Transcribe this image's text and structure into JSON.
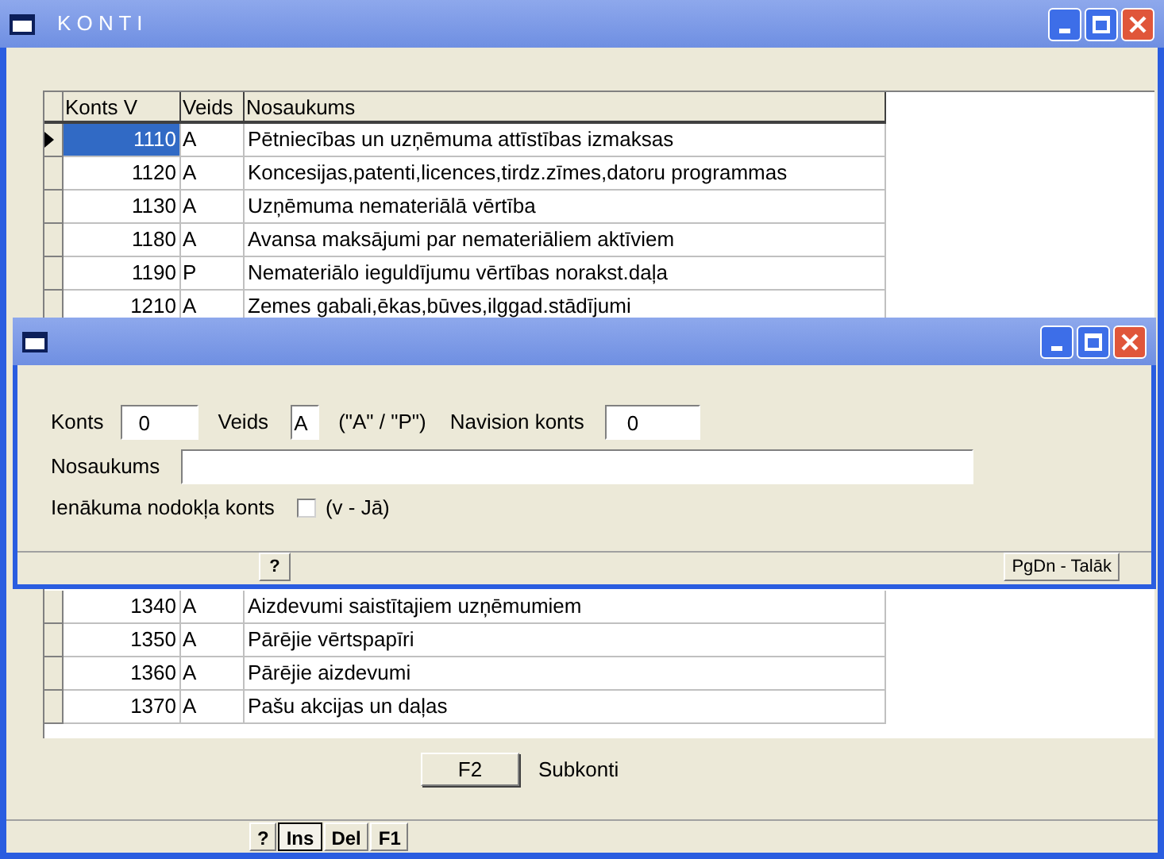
{
  "window": {
    "title": "K O N T I"
  },
  "table": {
    "columns": [
      "Konts V",
      "Veids",
      "Nosaukums"
    ],
    "rows": [
      {
        "konts": "1110",
        "veids": "A",
        "nosaukums": "Pētniecības un uzņēmuma attīstības izmaksas",
        "selected": true
      },
      {
        "konts": "1120",
        "veids": "A",
        "nosaukums": "Koncesijas,patenti,licences,tirdz.zīmes,datoru programmas",
        "selected": false
      },
      {
        "konts": "1130",
        "veids": "A",
        "nosaukums": "Uzņēmuma nemateriālā vērtība",
        "selected": false
      },
      {
        "konts": "1180",
        "veids": "A",
        "nosaukums": "Avansa maksājumi par nemateriāliem aktīviem",
        "selected": false
      },
      {
        "konts": "1190",
        "veids": "P",
        "nosaukums": "Nemateriālo ieguldījumu vērtības norakst.daļa",
        "selected": false
      },
      {
        "konts": "1210",
        "veids": "A",
        "nosaukums": "Zemes gabali,ēkas,būves,ilggad.stādījumi",
        "selected": false
      }
    ],
    "rows_below": [
      {
        "konts": "1340",
        "veids": "A",
        "nosaukums": "Aizdevumi saistītajiem uzņēmumiem",
        "selected": false
      },
      {
        "konts": "1350",
        "veids": "A",
        "nosaukums": "Pārējie vērtspapīri",
        "selected": false
      },
      {
        "konts": "1360",
        "veids": "A",
        "nosaukums": "Pārējie aizdevumi",
        "selected": false
      },
      {
        "konts": "1370",
        "veids": "A",
        "nosaukums": "Pašu akcijas un daļas",
        "selected": false
      }
    ]
  },
  "f2_button": "F2",
  "f2_label": "Subkonti",
  "status_buttons": [
    {
      "label": "?",
      "selected": false
    },
    {
      "label": "Ins",
      "selected": true
    },
    {
      "label": "Del",
      "selected": false
    },
    {
      "label": "F1",
      "selected": false
    }
  ],
  "dialog": {
    "konts_label": "Konts",
    "konts_value": "0",
    "veids_label": "Veids",
    "veids_value": "A",
    "veids_hint": "(\"A\" / \"P\")",
    "navision_label": "Navision konts",
    "navision_value": "0",
    "nosaukums_label": "Nosaukums",
    "nodoklis_label": "Ienākuma nodokļa konts",
    "nodoklis_checked": false,
    "nodoklis_hint": "(v - Jā)",
    "help_button": "?",
    "next_button": "PgDn - Talāk"
  }
}
